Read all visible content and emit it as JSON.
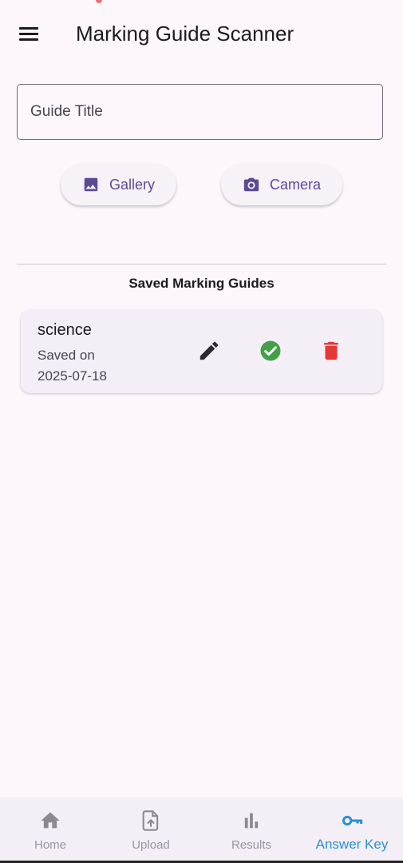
{
  "app_bar": {
    "title": "Marking Guide Scanner",
    "menu_icon": "menu-icon"
  },
  "guide_title_field": {
    "value": "",
    "placeholder": "Guide Title"
  },
  "buttons": {
    "gallery": {
      "label": "Gallery",
      "icon": "image-icon"
    },
    "camera": {
      "label": "Camera",
      "icon": "camera-icon"
    }
  },
  "saved_section": {
    "title": "Saved Marking Guides"
  },
  "guides": [
    {
      "name": "science",
      "saved_text": "Saved on 2025-07-18"
    }
  ],
  "card_actions": {
    "edit_icon": "pencil-icon",
    "select_icon": "check-circle-icon",
    "delete_icon": "trash-icon"
  },
  "bottom_nav": {
    "items": [
      {
        "label": "Home",
        "icon": "home-icon"
      },
      {
        "label": "Upload",
        "icon": "upload-file-icon"
      },
      {
        "label": "Results",
        "icon": "bar-chart-icon"
      },
      {
        "label": "Answer Key",
        "icon": "key-icon",
        "active": true
      }
    ]
  },
  "colors": {
    "background": "#fdf7fc",
    "accent": "#5c4a94",
    "active_nav": "#2c8fd4",
    "success": "#43a047",
    "danger": "#e53935",
    "inactive_nav": "#9a959e"
  }
}
